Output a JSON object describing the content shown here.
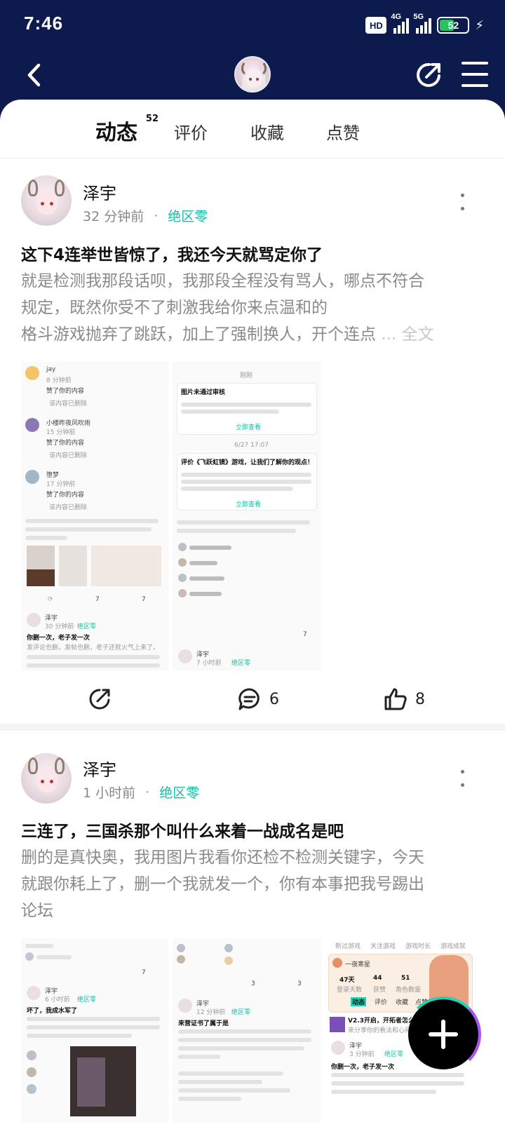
{
  "status_bar": {
    "time": "7:46",
    "hd_label": "HD",
    "net1": "4G",
    "net2": "5G",
    "battery": "52",
    "battery_level_percent": 52
  },
  "header": {
    "back_icon": "back-arrow-icon",
    "share_icon": "share-icon",
    "menu_icon": "menu-icon"
  },
  "tabs": [
    {
      "label": "动态",
      "badge": "52",
      "active": true
    },
    {
      "label": "评价"
    },
    {
      "label": "收藏"
    },
    {
      "label": "点赞"
    }
  ],
  "posts": [
    {
      "author": "泽宇",
      "time": "32 分钟前",
      "separator": "·",
      "tag": "绝区零",
      "title": "这下4连举世皆惊了，我还今天就骂定你了",
      "body_lines": [
        "就是检测我那段话呗，我那段全程没有骂人，哪点不符合",
        "规定，既然你受不了刺激我给你来点温和的",
        "格斗游戏抛弃了跳跃，加上了强制换人，开个连点"
      ],
      "ellipsis": "...",
      "more_text": "全文",
      "comments": "6",
      "likes": "8",
      "thumb1": {
        "n1": "jay",
        "t1": "8 分钟前",
        "a1": "赞了你的内容",
        "d1": "该内容已删除",
        "n2": "小楼昨夜风吹雨",
        "t2": "15 分钟前",
        "a2": "赞了你的内容",
        "d2": "该内容已删除",
        "n3": "堕梦",
        "t3": "17 分钟前",
        "a3": "赞了你的内容",
        "d3": "该内容已删除",
        "c7": "7",
        "l7": "7",
        "u": "泽宇",
        "ut": "30 分钟前",
        "ug": "绝区零",
        "ti": "你删一次，老子发一次",
        "b1": "发评论也删，发帖也删，老子还就火气上来了。"
      },
      "thumb2": {
        "h": "刚刚",
        "k1": "图片未通过审核",
        "k1b": "你好，你在动态《删的是真快...》发布的图片未通过审核，请尽快修改，点击前往修改。",
        "k1c": "立即查看",
        "d": "6/27 17:07",
        "k2": "评价《飞跃虹镜》游戏，让我们了解你的观点！",
        "k2c": "立即查看",
        "c7": "7",
        "u": "泽宇",
        "ut": "7 小时前",
        "ug": "绝区零"
      }
    },
    {
      "author": "泽宇",
      "time": "1 小时前",
      "separator": "·",
      "tag": "绝区零",
      "title": "三连了，三国杀那个叫什么来着一战成名是吧",
      "body_lines": [
        "删的是真快奥，我用图片我看你还检不检测关键字，今天",
        "就跟你耗上了，删一个我就发一个，你有本事把我号踢出",
        "论坛"
      ],
      "thumb1": {
        "l7": "7",
        "u": "泽宇",
        "ut": "6 小时前",
        "ug": "绝区零",
        "ti": "坏了，我成水军了"
      },
      "thumb2": {
        "c3": "3",
        "l3": "3",
        "u": "泽宇",
        "ut": "12 分钟前",
        "ug": "绝区零",
        "ti": "来营证书了属于是"
      },
      "thumb3": {
        "tabs": [
          "新过游戏",
          "关注游戏",
          "游戏时长",
          "游戏成就"
        ],
        "p": "一夜寒星",
        "s1": "47天",
        "s1l": "登录天数",
        "s2": "44",
        "s2l": "获赞",
        "s3": "51",
        "s3l": "角色数量",
        "t1": "动态",
        "t2": "评价",
        "t3": "收藏",
        "t4": "点赞",
        "q": "V2.3开启，开拓者怎么看?",
        "q2": "来分享你的看法和心得吧!",
        "u": "泽宇",
        "ut": "3 分钟前",
        "ug": "绝区零",
        "ti": "你删一次，老子发一次"
      }
    }
  ],
  "fab_icon": "plus-icon"
}
